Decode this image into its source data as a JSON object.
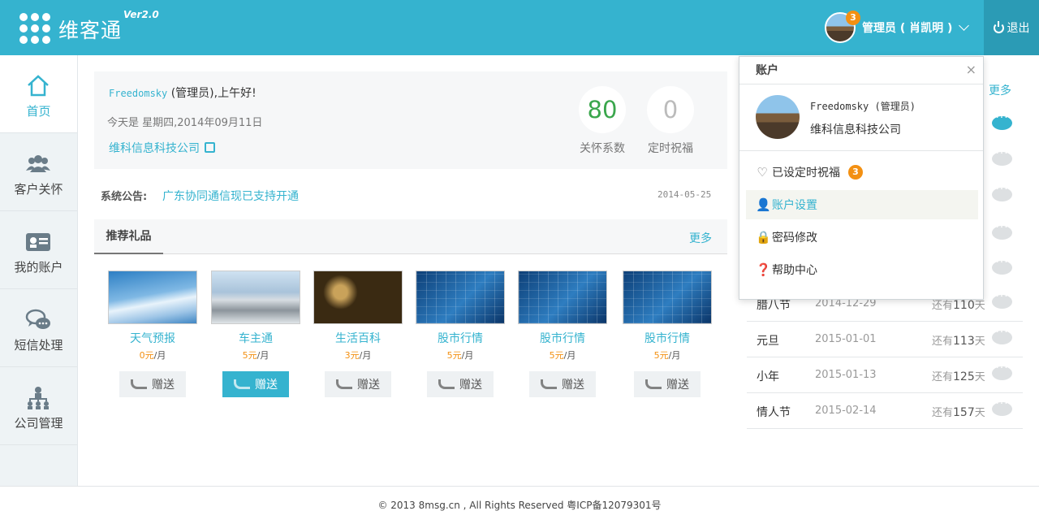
{
  "header": {
    "brand": "维客通",
    "version": "Ver2.0",
    "user_name": "管理员 ( 肖凯明 )",
    "notification_count": "3",
    "logout_label": "退出",
    "accent_color": "#35b3cf"
  },
  "sidebar": {
    "items": [
      {
        "label": "首页",
        "icon": "home-icon"
      },
      {
        "label": "客户关怀",
        "icon": "users-icon"
      },
      {
        "label": "我的账户",
        "icon": "id-card-icon"
      },
      {
        "label": "短信处理",
        "icon": "chat-icon"
      },
      {
        "label": "公司管理",
        "icon": "org-chart-icon"
      }
    ]
  },
  "welcome": {
    "username": "Freedomsky",
    "greeting_suffix": " (管理员),上午好!",
    "date_line": "今天是 星期四,2014年09月11日",
    "company": "维科信息科技公司",
    "care_value": "80",
    "care_label": "关怀系数",
    "timed_value": "0",
    "timed_label": "定时祝福"
  },
  "notice": {
    "label": "系统公告:",
    "text": "广东协同通信现已支持开通",
    "date": "2014-05-25"
  },
  "gifts": {
    "tab_label": "推荐礼品",
    "more_label": "更多",
    "items": [
      {
        "name": "天气预报",
        "price": "0元",
        "unit": "/月",
        "send": "赠送"
      },
      {
        "name": "车主通",
        "price": "5元",
        "unit": "/月",
        "send": "赠送"
      },
      {
        "name": "生活百科",
        "price": "3元",
        "unit": "/月",
        "send": "赠送"
      },
      {
        "name": "股市行情",
        "price": "5元",
        "unit": "/月",
        "send": "赠送"
      },
      {
        "name": "股市行情",
        "price": "5元",
        "unit": "/月",
        "send": "赠送"
      },
      {
        "name": "股市行情",
        "price": "5元",
        "unit": "/月",
        "send": "赠送"
      }
    ]
  },
  "festivals": {
    "more_label": "更多",
    "remain_prefix": "还有",
    "remain_suffix": "天",
    "rows": [
      {
        "name": "腊八节",
        "date": "2014-12-29",
        "days": "110"
      },
      {
        "name": "元旦",
        "date": "2015-01-01",
        "days": "113"
      },
      {
        "name": "小年",
        "date": "2015-01-13",
        "days": "125"
      },
      {
        "name": "情人节",
        "date": "2015-02-14",
        "days": "157"
      }
    ]
  },
  "dropdown": {
    "title": "账户",
    "close": "×",
    "user": "Freedomsky (管理员)",
    "company": "维科信息科技公司",
    "items": [
      {
        "label": "已设定时祝福",
        "badge": "3",
        "icon": "heart-icon"
      },
      {
        "label": "账户设置",
        "icon": "user-icon"
      },
      {
        "label": "密码修改",
        "icon": "lock-icon"
      },
      {
        "label": "帮助中心",
        "icon": "help-icon"
      }
    ]
  },
  "footer": {
    "text": "© 2013 8msg.cn , All Rights Reserved 粤ICP备12079301号"
  }
}
